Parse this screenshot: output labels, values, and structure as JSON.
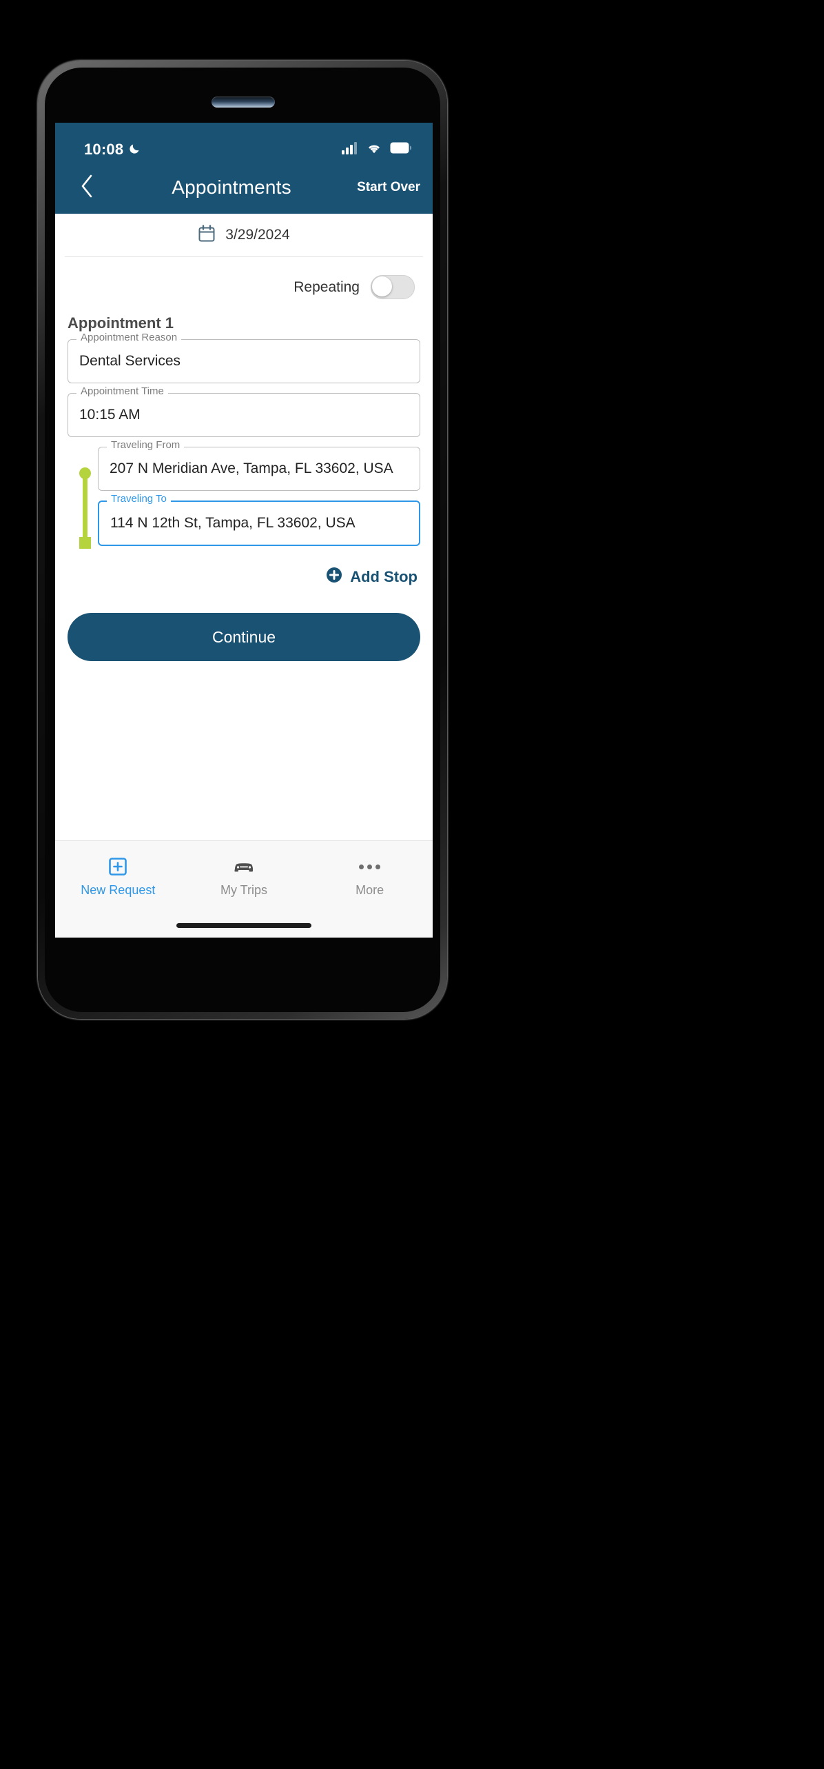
{
  "statusbar": {
    "time": "10:08",
    "moon_icon": "crescent-moon-icon",
    "signal_icon": "cellular-signal-icon",
    "wifi_icon": "wifi-icon",
    "battery_icon": "battery-icon"
  },
  "navbar": {
    "back_icon": "chevron-left-icon",
    "title": "Appointments",
    "action_label": "Start Over"
  },
  "date_row": {
    "calendar_icon": "calendar-icon",
    "date": "3/29/2024"
  },
  "repeating": {
    "label": "Repeating",
    "state": "off"
  },
  "appointment": {
    "section_title": "Appointment 1",
    "fields": [
      {
        "label": "Appointment Reason",
        "value": "Dental Services",
        "focused": false
      },
      {
        "label": "Appointment Time",
        "value": "10:15 AM",
        "focused": false
      },
      {
        "label": "Traveling From",
        "value": "207 N Meridian Ave, Tampa, FL 33602, USA",
        "focused": false
      },
      {
        "label": "Traveling To",
        "value": "114 N 12th St, Tampa, FL 33602, USA",
        "focused": true
      }
    ]
  },
  "add_stop": {
    "label": "Add Stop",
    "icon": "plus-circle-icon"
  },
  "continue_button": {
    "label": "Continue"
  },
  "tabbar": {
    "items": [
      {
        "label": "New Request",
        "icon": "boxed-plus-icon",
        "active": true
      },
      {
        "label": "My Trips",
        "icon": "car-icon",
        "active": false
      },
      {
        "label": "More",
        "icon": "ellipsis-icon",
        "active": false
      }
    ]
  },
  "colors": {
    "header_blue": "#1a5274",
    "accent_blue": "#2f97e8",
    "route_green": "#b5d33d",
    "screen_bg": "#ffffff",
    "tabbar_bg": "#f8f8f8"
  }
}
